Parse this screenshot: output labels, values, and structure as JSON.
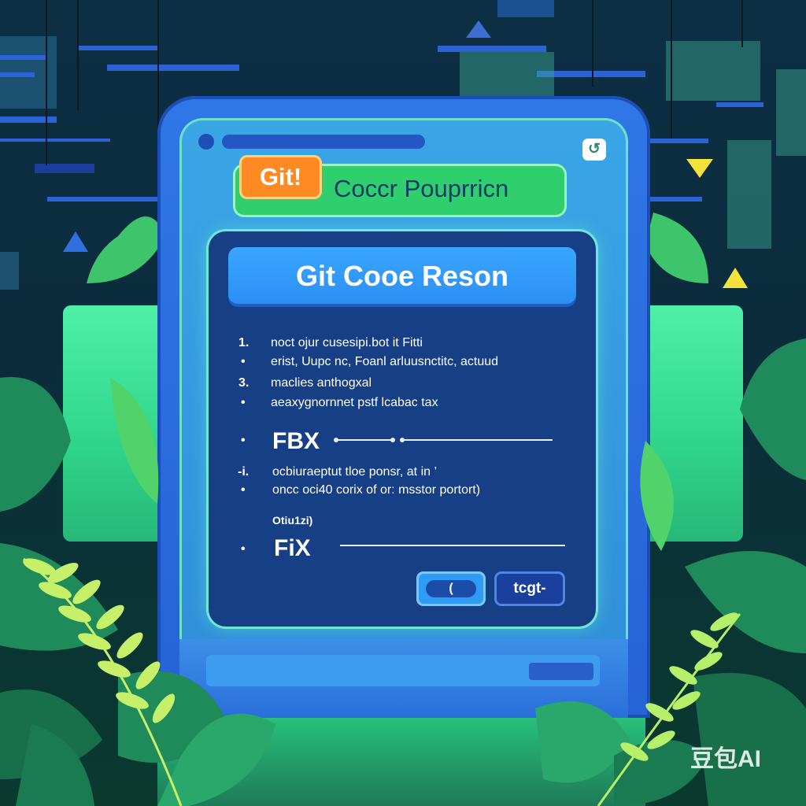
{
  "header": {
    "badge": "Git!",
    "title": "Coccr Pouprricn",
    "corner_icon": "refresh-icon"
  },
  "dialog": {
    "title": "Git Cooe Reson",
    "items": [
      {
        "marker": "1.",
        "text": "noct ojur cusesipi.bot it Fitti"
      },
      {
        "marker": "•",
        "text": "erist, Uupc nc, Foanl arluusnctitc, actuud"
      },
      {
        "marker": "3.",
        "text": "maclies anthogxal"
      },
      {
        "marker": "•",
        "text": "aeaxygnornnet pstf lcabac tax"
      }
    ],
    "fix_rows": [
      {
        "marker": "•",
        "label": "FBX"
      },
      {
        "marker": "•",
        "label": "FiX"
      }
    ],
    "items_2": [
      {
        "marker": "-i.",
        "text": "ocbiuraeptut tloe ponsr, at in ’"
      },
      {
        "marker": "•",
        "text": "oncc oci40 corix of or: msstor portort)"
      }
    ],
    "section_label": "Otiu1zi)",
    "buttons": {
      "left_label": "(",
      "right_label": "tcgt-"
    }
  },
  "watermark": "豆包AI",
  "colors": {
    "background": "#0c2c3c",
    "monitor": "#2f77e6",
    "dialog": "#173f86",
    "header_bar": "#2fcf6e",
    "badge": "#ff8a24",
    "title_bar": "#3aa6ff",
    "leaf_dark": "#1f8a5a",
    "leaf_light": "#9be86a"
  }
}
